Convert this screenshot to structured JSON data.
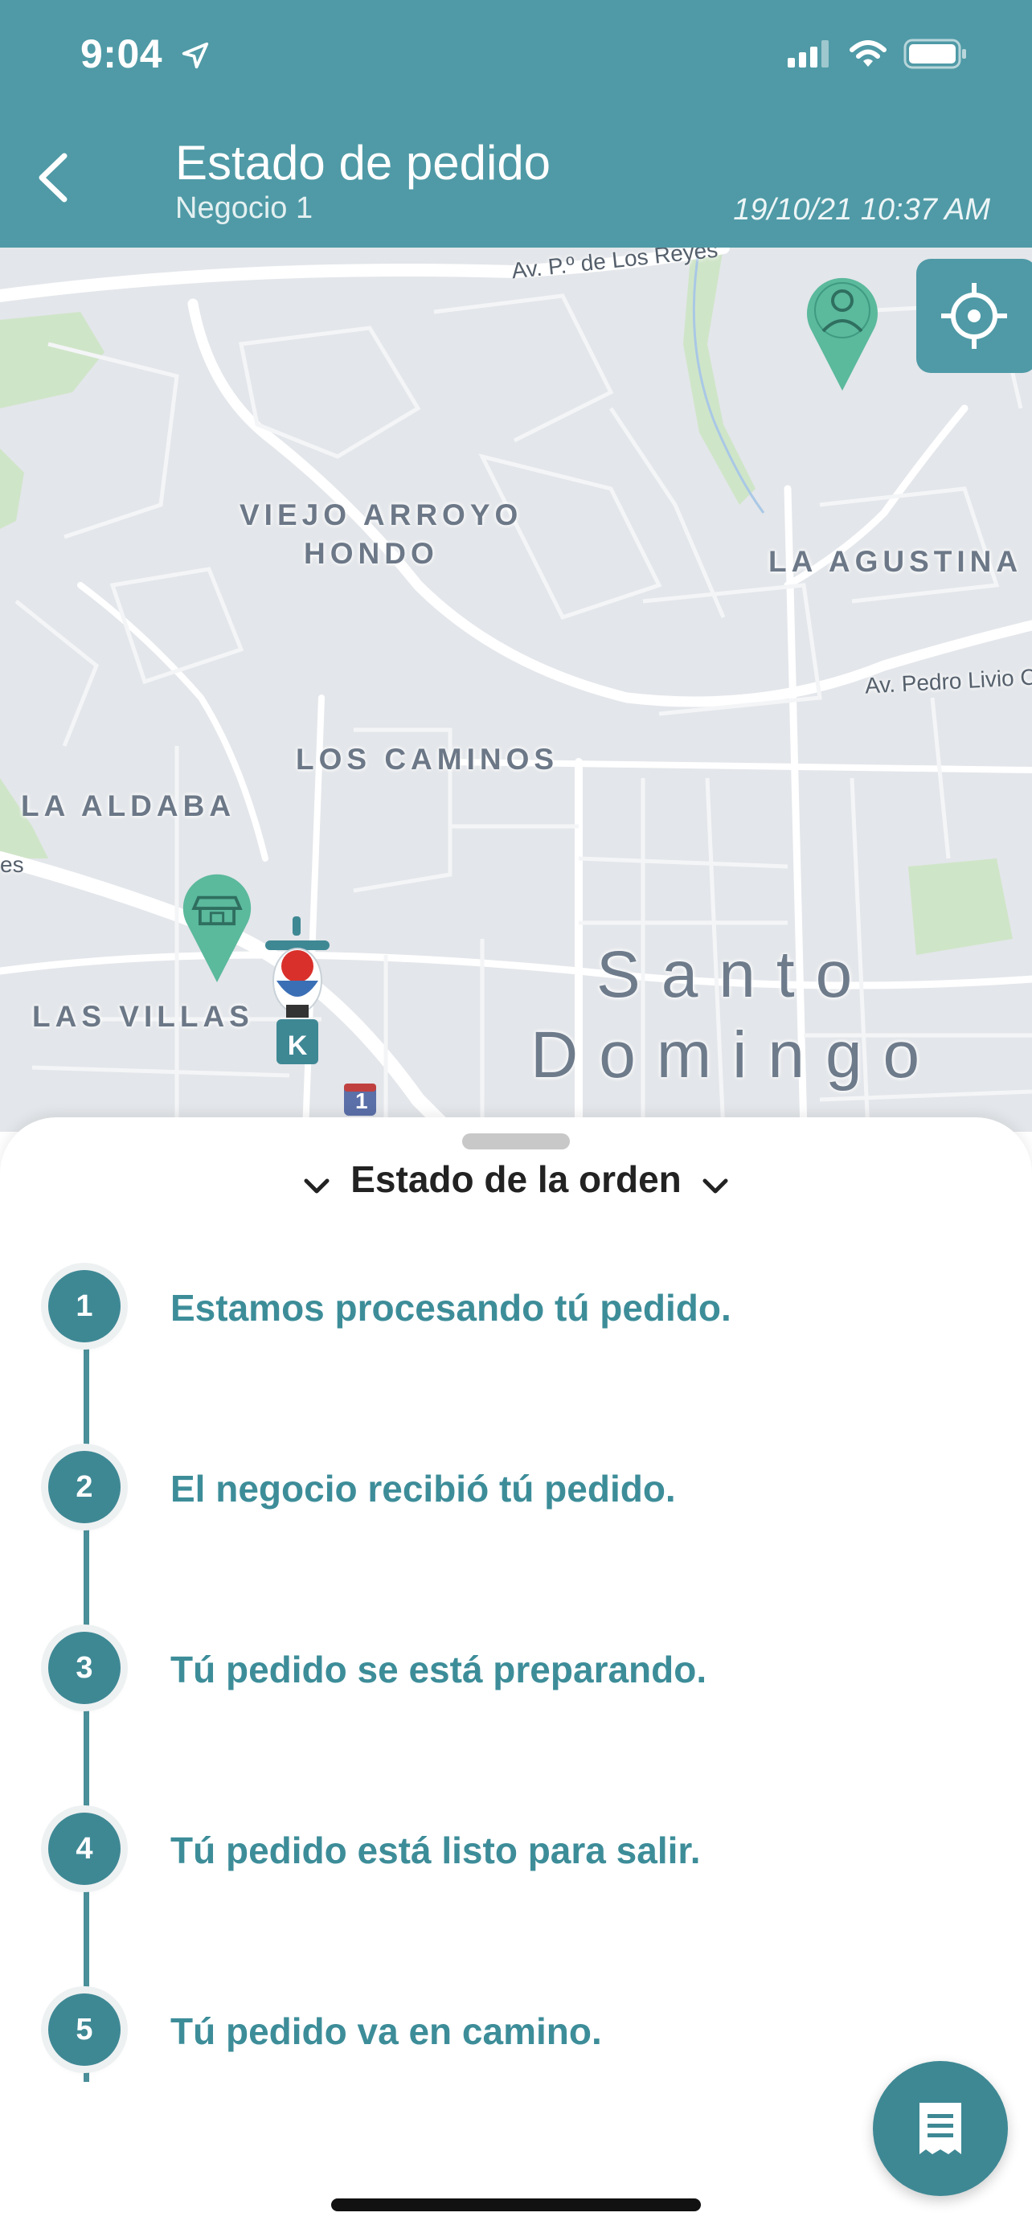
{
  "status_bar": {
    "time": "9:04"
  },
  "header": {
    "title": "Estado de pedido",
    "subtitle": "Negocio 1",
    "datetime": "19/10/21 10:37 AM",
    "back_icon": "chevron-left-icon"
  },
  "map": {
    "labels": {
      "viejo_arroyo_1": "VIEJO ARROYO",
      "viejo_arroyo_2": "HONDO",
      "la_agustina": "LA AGUSTINA",
      "los_caminos": "LOS CAMINOS",
      "la_aldaba": "LA ALDABA",
      "las_villas": "LAS VILLAS",
      "santo": "Santo",
      "domingo": "Domingo",
      "road_reyes": "Av. P.º de Los Reyes",
      "road_pedro": "Av. Pedro Livio C",
      "road_es": "es",
      "route_1": "1"
    },
    "pins": [
      "user-pin-icon",
      "store-pin-icon",
      "courier-icon"
    ],
    "accent": "#4f9aa6"
  },
  "sheet": {
    "title": "Estado de la orden",
    "steps": [
      {
        "number": "1",
        "text": "Estamos procesando tú pedido."
      },
      {
        "number": "2",
        "text": "El negocio recibió tú pedido."
      },
      {
        "number": "3",
        "text": "Tú pedido se está preparando."
      },
      {
        "number": "4",
        "text": "Tú pedido está listo para salir."
      },
      {
        "number": "5",
        "text": "Tú pedido va en camino."
      }
    ]
  },
  "receipt_button_icon": "receipt-icon"
}
